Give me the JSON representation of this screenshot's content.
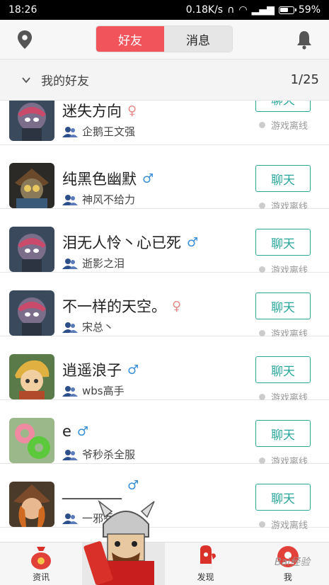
{
  "status_bar": {
    "time": "18:26",
    "network_speed": "0.18K/s",
    "battery": "59%"
  },
  "header": {
    "tabs": [
      "好友",
      "消息"
    ],
    "active_tab": "好友"
  },
  "group": {
    "title": "我的好友",
    "count": "1/25"
  },
  "friends": [
    {
      "name": "迷失方向",
      "gender": "female",
      "server": "企鹅王文强",
      "button": "聊天",
      "status": "游戏离线"
    },
    {
      "name": "纯黑色幽默",
      "gender": "male",
      "server": "神风不给力",
      "button": "聊天",
      "status": "游戏离线"
    },
    {
      "name": "泪无人怜丶心已死",
      "gender": "male",
      "server": "逝影之泪",
      "button": "聊天",
      "status": "游戏离线"
    },
    {
      "name": "不一样的天空。",
      "gender": "female",
      "server": "宋总丶",
      "button": "聊天",
      "status": "游戏离线"
    },
    {
      "name": "逍遥浪子",
      "gender": "male",
      "server": "wbs高手",
      "button": "聊天",
      "status": "游戏离线"
    },
    {
      "name": "e",
      "gender": "male",
      "server": "爷秒杀全服",
      "button": "聊天",
      "status": "游戏离线"
    },
    {
      "name": "________",
      "gender": "male",
      "server": "一邪乔",
      "button": "聊天",
      "status": "游戏离线"
    }
  ],
  "tabbar": {
    "tabs": [
      "资讯",
      "",
      "发现",
      "我"
    ]
  },
  "watermark": "Bai经验",
  "colors": {
    "accent": "#f2545b",
    "chat_button": "#2aa79b",
    "male": "#3a8fd8",
    "female": "#e68a8a"
  }
}
